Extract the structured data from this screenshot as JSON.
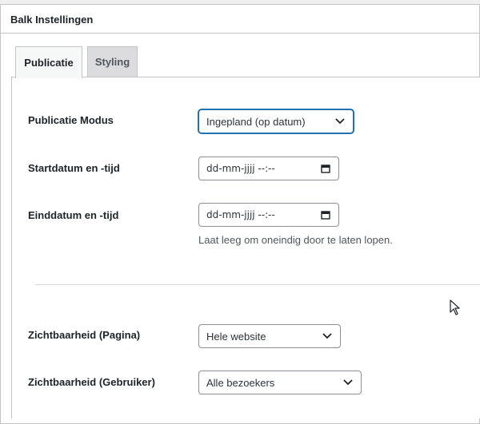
{
  "panel": {
    "title": "Balk Instellingen"
  },
  "tabs": [
    {
      "label": "Publicatie",
      "active": true
    },
    {
      "label": "Styling",
      "active": false
    }
  ],
  "fields": {
    "mode": {
      "label": "Publicatie Modus",
      "value": "Ingepland (op datum)"
    },
    "start": {
      "label": "Startdatum en -tijd",
      "value": "dd-mm-jjjj --:--"
    },
    "end": {
      "label": "Einddatum en -tijd",
      "value": "dd-mm-jjjj --:--",
      "hint": "Laat leeg om oneindig door te laten lopen."
    },
    "visibility_page": {
      "label": "Zichtbaarheid (Pagina)",
      "value": "Hele website"
    },
    "visibility_user": {
      "label": "Zichtbaarheid (Gebruiker)",
      "value": "Alle bezoekers"
    }
  },
  "colors": {
    "accent": "#2271b1",
    "border": "#c3c4c7",
    "tab_inactive": "#dcdcde"
  },
  "icons": [
    "chevron-down-icon",
    "calendar-icon",
    "mouse-cursor-icon"
  ]
}
